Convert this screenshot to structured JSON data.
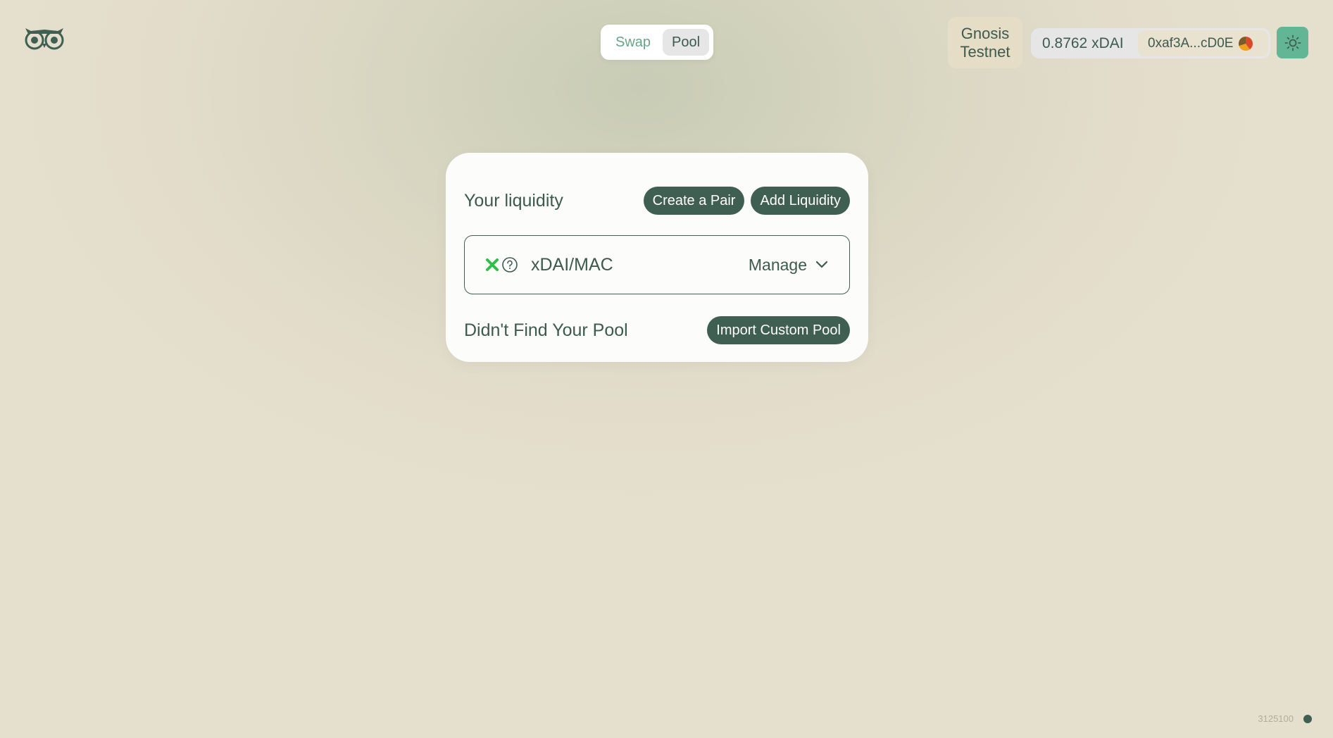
{
  "header": {
    "logo_icon": "owl-logo-icon",
    "nav": {
      "swap_label": "Swap",
      "pool_label": "Pool",
      "active": "Pool"
    },
    "network": {
      "line1": "Gnosis",
      "line2": "Testnet"
    },
    "wallet": {
      "balance": "0.8762 xDAI",
      "address": "0xaf3A...cD0E"
    },
    "theme_icon": "sun-icon"
  },
  "card": {
    "heading": "Your liquidity",
    "create_pair_label": "Create a Pair",
    "add_liquidity_label": "Add Liquidity",
    "pool": {
      "pair": "xDAI/MAC",
      "token_icons": [
        "xdai-token-icon",
        "unknown-token-icon"
      ],
      "manage_label": "Manage"
    },
    "not_found_text": "Didn't Find Your Pool",
    "import_label": "Import Custom Pool"
  },
  "footer": {
    "block_number": "3125100"
  },
  "colors": {
    "accent_dark": "#3f5f52",
    "accent_light": "#62b595",
    "background": "#e5dfcd"
  }
}
